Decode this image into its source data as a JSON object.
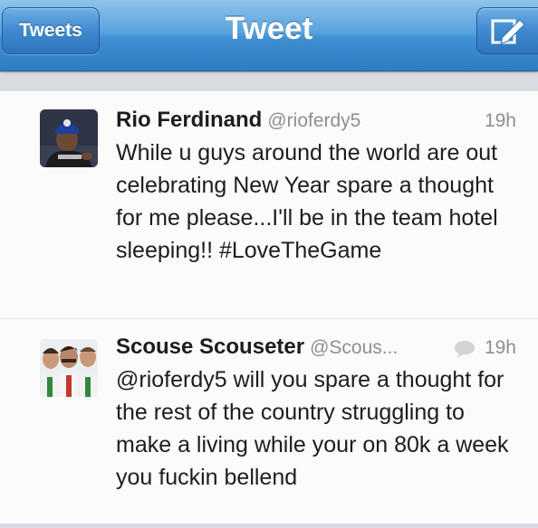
{
  "navbar": {
    "back_label": "Tweets",
    "title": "Tweet",
    "compose_icon": "compose-icon"
  },
  "tweets": [
    {
      "name": "Rio Ferdinand",
      "handle": "@rioferdy5",
      "time": "19h",
      "text": "While u guys around the world are out celebrating New Year spare a thought for me please...I'll be in the team hotel sleeping!! #LoveTheGame"
    },
    {
      "name": "Scouse Scouseter",
      "handle": "@Scous...",
      "time": "19h",
      "reply_icon": "speech-bubble-icon",
      "text": "@rioferdy5 will you spare a thought for the rest of the country struggling to make a living while your on 80k a week you fuckin bellend"
    }
  ],
  "colors": {
    "nav_blue": "#3f8fd2",
    "meta_gray": "#8e8e93"
  }
}
